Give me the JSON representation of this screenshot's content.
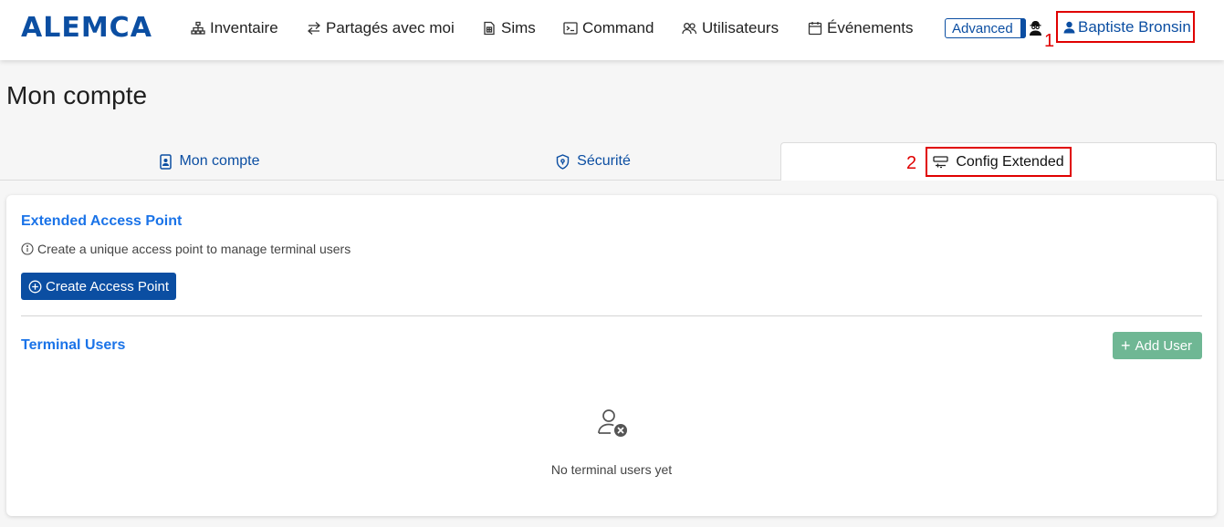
{
  "header": {
    "logo": "ALEMCA",
    "nav": [
      {
        "label": "Inventaire",
        "icon": "sitemap-icon"
      },
      {
        "label": "Partagés avec moi",
        "icon": "arrows-exchange-icon"
      },
      {
        "label": "Sims",
        "icon": "sim-card-icon"
      },
      {
        "label": "Command",
        "icon": "terminal-icon"
      },
      {
        "label": "Utilisateurs",
        "icon": "users-icon"
      },
      {
        "label": "Événements",
        "icon": "calendar-icon"
      }
    ],
    "advanced_label": "Advanced",
    "agent_icon": "user-secret-icon",
    "user_name": "Baptiste Bronsin",
    "annotation_1": "1"
  },
  "page": {
    "title": "Mon compte"
  },
  "tabs": [
    {
      "label": "Mon compte",
      "icon": "id-badge-icon",
      "active": false
    },
    {
      "label": "Sécurité",
      "icon": "shield-icon",
      "active": false
    },
    {
      "label": "Config Extended",
      "icon": "sliders-icon",
      "active": true
    }
  ],
  "annotation_2": "2",
  "card": {
    "access_title": "Extended Access Point",
    "access_hint": "Create a unique access point to manage terminal users",
    "create_button": "Create Access Point",
    "users_title": "Terminal Users",
    "add_user_button": "Add User",
    "empty_text": "No terminal users yet"
  },
  "colors": {
    "brand": "#0b4ea2",
    "link": "#1a73e8",
    "highlight": "#e00000",
    "add_button": "#6fb794"
  }
}
